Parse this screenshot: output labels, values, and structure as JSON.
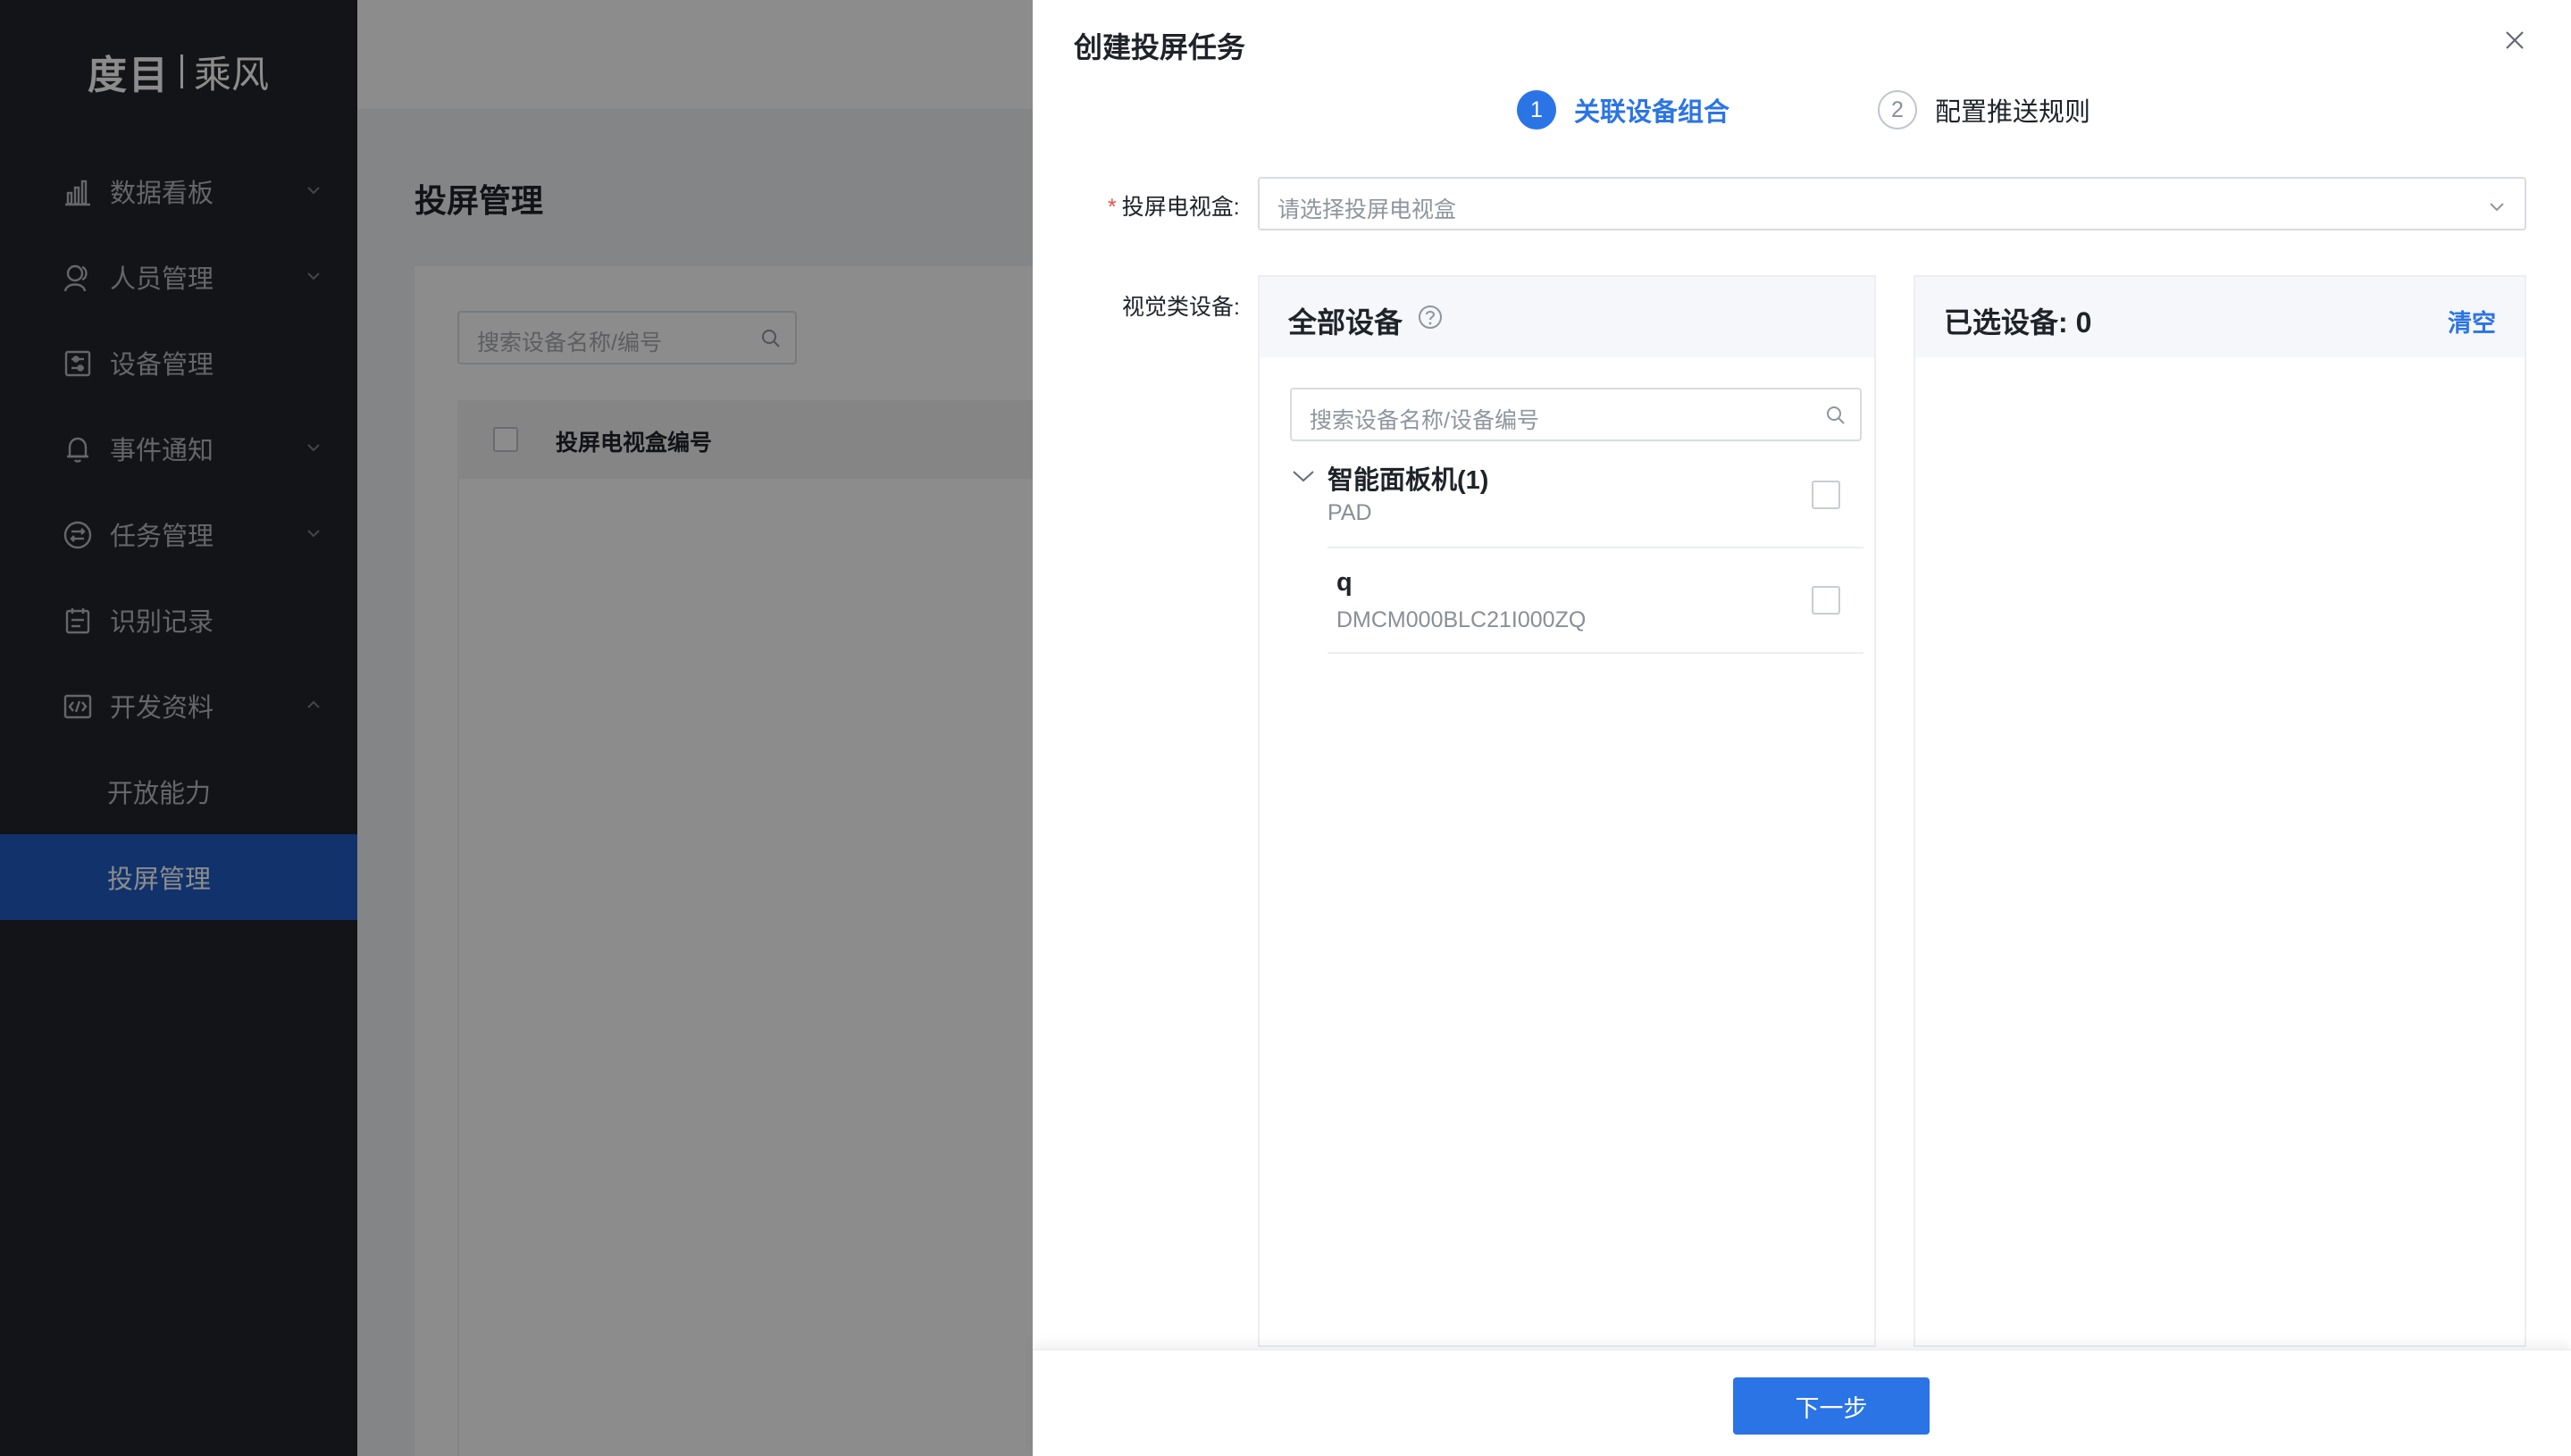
{
  "sidebar": {
    "logo_main": "度目",
    "logo_sub": "乘风",
    "items": [
      {
        "label": "数据看板",
        "icon": "bar-chart-icon",
        "expandable": true
      },
      {
        "label": "人员管理",
        "icon": "people-icon",
        "expandable": true
      },
      {
        "label": "设备管理",
        "icon": "device-settings-icon",
        "expandable": false
      },
      {
        "label": "事件通知",
        "icon": "bell-icon",
        "expandable": true
      },
      {
        "label": "任务管理",
        "icon": "task-icon",
        "expandable": true
      },
      {
        "label": "识别记录",
        "icon": "calendar-icon",
        "expandable": false
      },
      {
        "label": "开发资料",
        "icon": "code-icon",
        "expandable": true,
        "expanded": true
      }
    ],
    "sub_items": [
      {
        "label": "开放能力",
        "active": false
      },
      {
        "label": "投屏管理",
        "active": true
      }
    ]
  },
  "main": {
    "page_title": "投屏管理",
    "search_placeholder": "搜索设备名称/编号",
    "table_header": "投屏电视盒编号"
  },
  "drawer": {
    "title": "创建投屏任务",
    "steps": [
      {
        "number": "1",
        "label": "关联设备组合",
        "active": true
      },
      {
        "number": "2",
        "label": "配置推送规则",
        "active": false
      }
    ],
    "tv_box_label": "投屏电视盒:",
    "tv_box_placeholder": "请选择投屏电视盒",
    "visual_label": "视觉类设备:",
    "all_devices": {
      "title": "全部设备",
      "search_placeholder": "搜索设备名称/设备编号",
      "group_name": "智能面板机(1)",
      "group_type": "PAD",
      "devices": [
        {
          "name": "q",
          "code": "DMCM000BLC21I000ZQ"
        }
      ]
    },
    "selected": {
      "title": "已选设备:",
      "count": "0",
      "clear_label": "清空"
    },
    "next_button": "下一步"
  },
  "colors": {
    "sidebar_bg": "#23252b",
    "active_nav": "#1f5cc4",
    "primary": "#2b74e6"
  }
}
